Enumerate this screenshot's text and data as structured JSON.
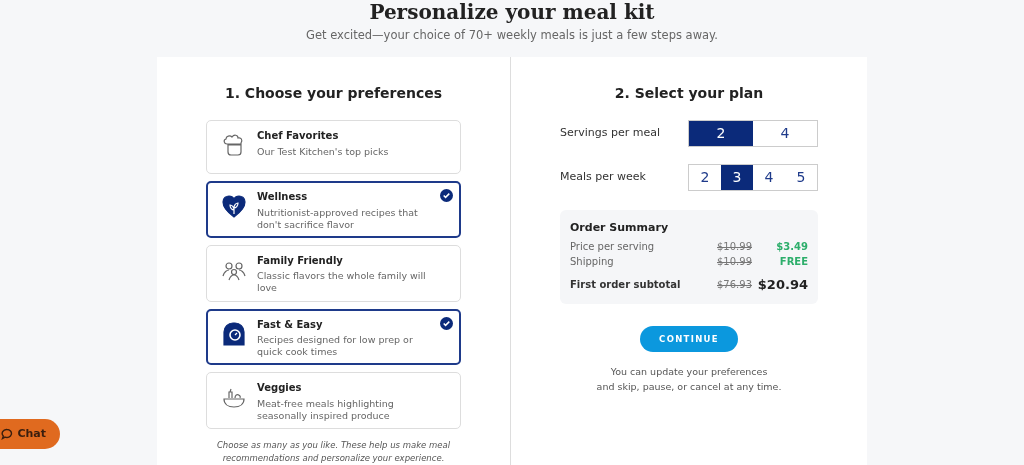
{
  "header": {
    "title": "Personalize your meal kit",
    "subtitle": "Get excited—your choice of 70+ weekly meals is just a few steps away."
  },
  "preferences": {
    "heading": "1. Choose your preferences",
    "items": [
      {
        "title": "Chef Favorites",
        "description": "Our Test Kitchen's top picks",
        "selected": false
      },
      {
        "title": "Wellness",
        "description": "Nutritionist-approved recipes that don't sacrifice flavor",
        "selected": true
      },
      {
        "title": "Family Friendly",
        "description": "Classic flavors the whole family will love",
        "selected": false
      },
      {
        "title": "Fast & Easy",
        "description": "Recipes designed for low prep or quick cook times",
        "selected": true
      },
      {
        "title": "Veggies",
        "description": "Meat-free meals highlighting seasonally inspired produce",
        "selected": false
      }
    ],
    "note": "Choose as many as you like. These help us make meal recommendations and personalize your experience."
  },
  "plan": {
    "heading": "2. Select your plan",
    "options": [
      {
        "label": "Servings per meal",
        "choices": [
          {
            "label": "2",
            "selected": true
          },
          {
            "label": "4",
            "selected": false
          }
        ]
      },
      {
        "label": "Meals per week",
        "choices": [
          {
            "label": "2",
            "selected": false
          },
          {
            "label": "3",
            "selected": true
          },
          {
            "label": "4",
            "selected": false
          },
          {
            "label": "5",
            "selected": false
          }
        ]
      }
    ],
    "summary": {
      "title": "Order Summary",
      "rows": [
        {
          "label": "Price per serving",
          "old": "$10.99",
          "new": "$3.49",
          "kind": "saving"
        },
        {
          "label": "Shipping",
          "old": "$10.99",
          "new": "FREE",
          "kind": "saving"
        },
        {
          "label": "First order subtotal",
          "old": "$76.93",
          "new": "$20.94",
          "kind": "total"
        }
      ]
    },
    "button": "CONTINUE",
    "note_lines": [
      "You can update your preferences",
      "and skip, pause, or cancel at any time."
    ]
  },
  "chat": {
    "label": "Chat"
  }
}
